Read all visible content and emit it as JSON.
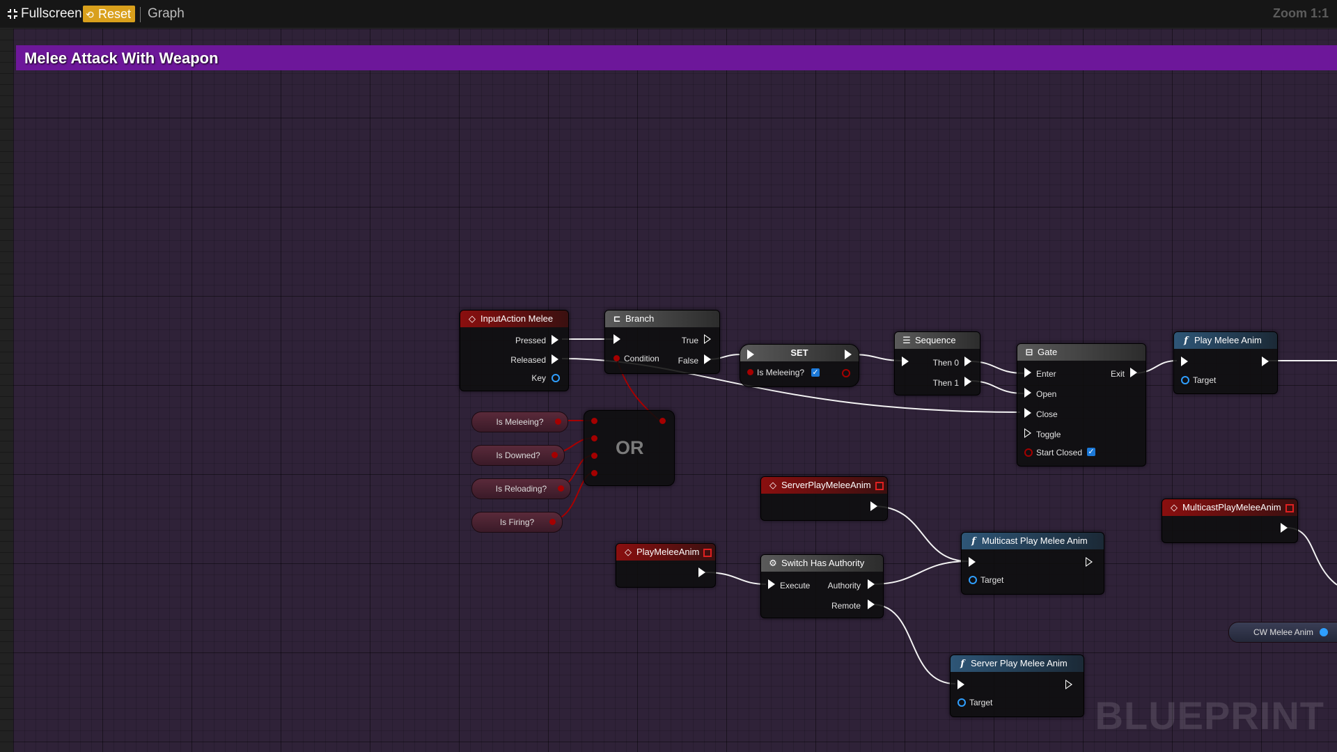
{
  "toolbar": {
    "fullscreen_label": "Fullscreen",
    "reset_label": "Reset",
    "graph_label": "Graph",
    "zoom_label": "Zoom 1:1"
  },
  "comment": {
    "title": "Melee Attack With Weapon"
  },
  "watermark": "BLUEPRINT",
  "nodes": {
    "input_action": {
      "title": "InputAction Melee",
      "pins": [
        "Pressed",
        "Released",
        "Key"
      ]
    },
    "branch": {
      "title": "Branch",
      "condition": "Condition",
      "true": "True",
      "false": "False"
    },
    "set": {
      "title": "SET",
      "var": "Is Meleeing?",
      "checked": true
    },
    "sequence": {
      "title": "Sequence",
      "then0": "Then 0",
      "then1": "Then 1"
    },
    "gate": {
      "title": "Gate",
      "pins": [
        "Enter",
        "Open",
        "Close",
        "Toggle"
      ],
      "exit": "Exit",
      "start_closed": "Start Closed",
      "checked": true
    },
    "play_melee_anim": {
      "title": "Play Melee Anim",
      "target": "Target"
    },
    "or": {
      "label": "OR"
    },
    "server_event": {
      "title": "ServerPlayMeleeAnim"
    },
    "multicast_event": {
      "title": "MulticastPlayMeleeAnim"
    },
    "multicast_call": {
      "title": "Multicast Play Melee Anim",
      "target": "Target"
    },
    "switch_authority": {
      "title": "Switch Has Authority",
      "execute": "Execute",
      "authority": "Authority",
      "remote": "Remote"
    },
    "play_event": {
      "title": "PlayMeleeAnim"
    },
    "server_call": {
      "title": "Server Play Melee Anim",
      "target": "Target"
    },
    "cw_var": {
      "label": "CW Melee Anim"
    }
  },
  "variables": [
    "Is Meleeing?",
    "Is Downed?",
    "Is Reloading?",
    "Is Firing?"
  ],
  "colors": {
    "comment": "#6d179a",
    "exec": "#ffffff",
    "bool": "#a50000",
    "object": "#2f9fff",
    "reset": "#d9a01c"
  },
  "icons": {
    "fullscreen": "fullscreen-icon",
    "reset": "reset-icon",
    "event": "event-diamond-icon",
    "branch": "branch-icon",
    "sequence": "sequence-icon",
    "gate": "gate-icon",
    "function": "function-icon",
    "authority": "gear-icon"
  }
}
